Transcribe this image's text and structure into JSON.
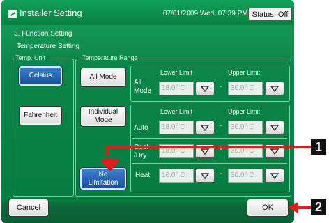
{
  "titlebar": {
    "title": "Installer Setting",
    "datetime": "07/01/2009 Wed. 07:39 PM",
    "status": "Status: Off",
    "icon": "settings-pencil-icon"
  },
  "breadcrumb": "3. Function Setting",
  "panel_title": "Temperature Setting",
  "temp_unit": {
    "label": "Temp. Unit",
    "celsius": "Celsius",
    "fahrenheit": "Fahrenheit",
    "selected": "Celsius"
  },
  "temperature_range": {
    "label": "Temperature Range",
    "all_mode_button": "All Mode",
    "individual_mode_button": "Individual Mode",
    "no_limitation_button": "No Limitation",
    "lower_limit_header": "Lower Limit",
    "upper_limit_header": "Upper Limit",
    "all_mode_row": {
      "label": "All Mode",
      "lower": "18.0° C",
      "upper": "30.0° C"
    },
    "individual_rows": [
      {
        "label": "Auto",
        "lower": "18.0° C",
        "upper": "30.0° C"
      },
      {
        "label": "Cool /Dry",
        "lower": "18.0° C",
        "upper": "30.0° C"
      },
      {
        "label": "Heat",
        "lower": "16.0° C",
        "upper": "30.0° C"
      }
    ],
    "dash": "-"
  },
  "footer": {
    "cancel": "Cancel",
    "ok": "OK"
  },
  "callouts": {
    "one": "1",
    "two": "2"
  },
  "colors": {
    "background": "#0b8648",
    "selected_button": "#1a4f9c",
    "callout_arrow": "#e31b1b"
  }
}
